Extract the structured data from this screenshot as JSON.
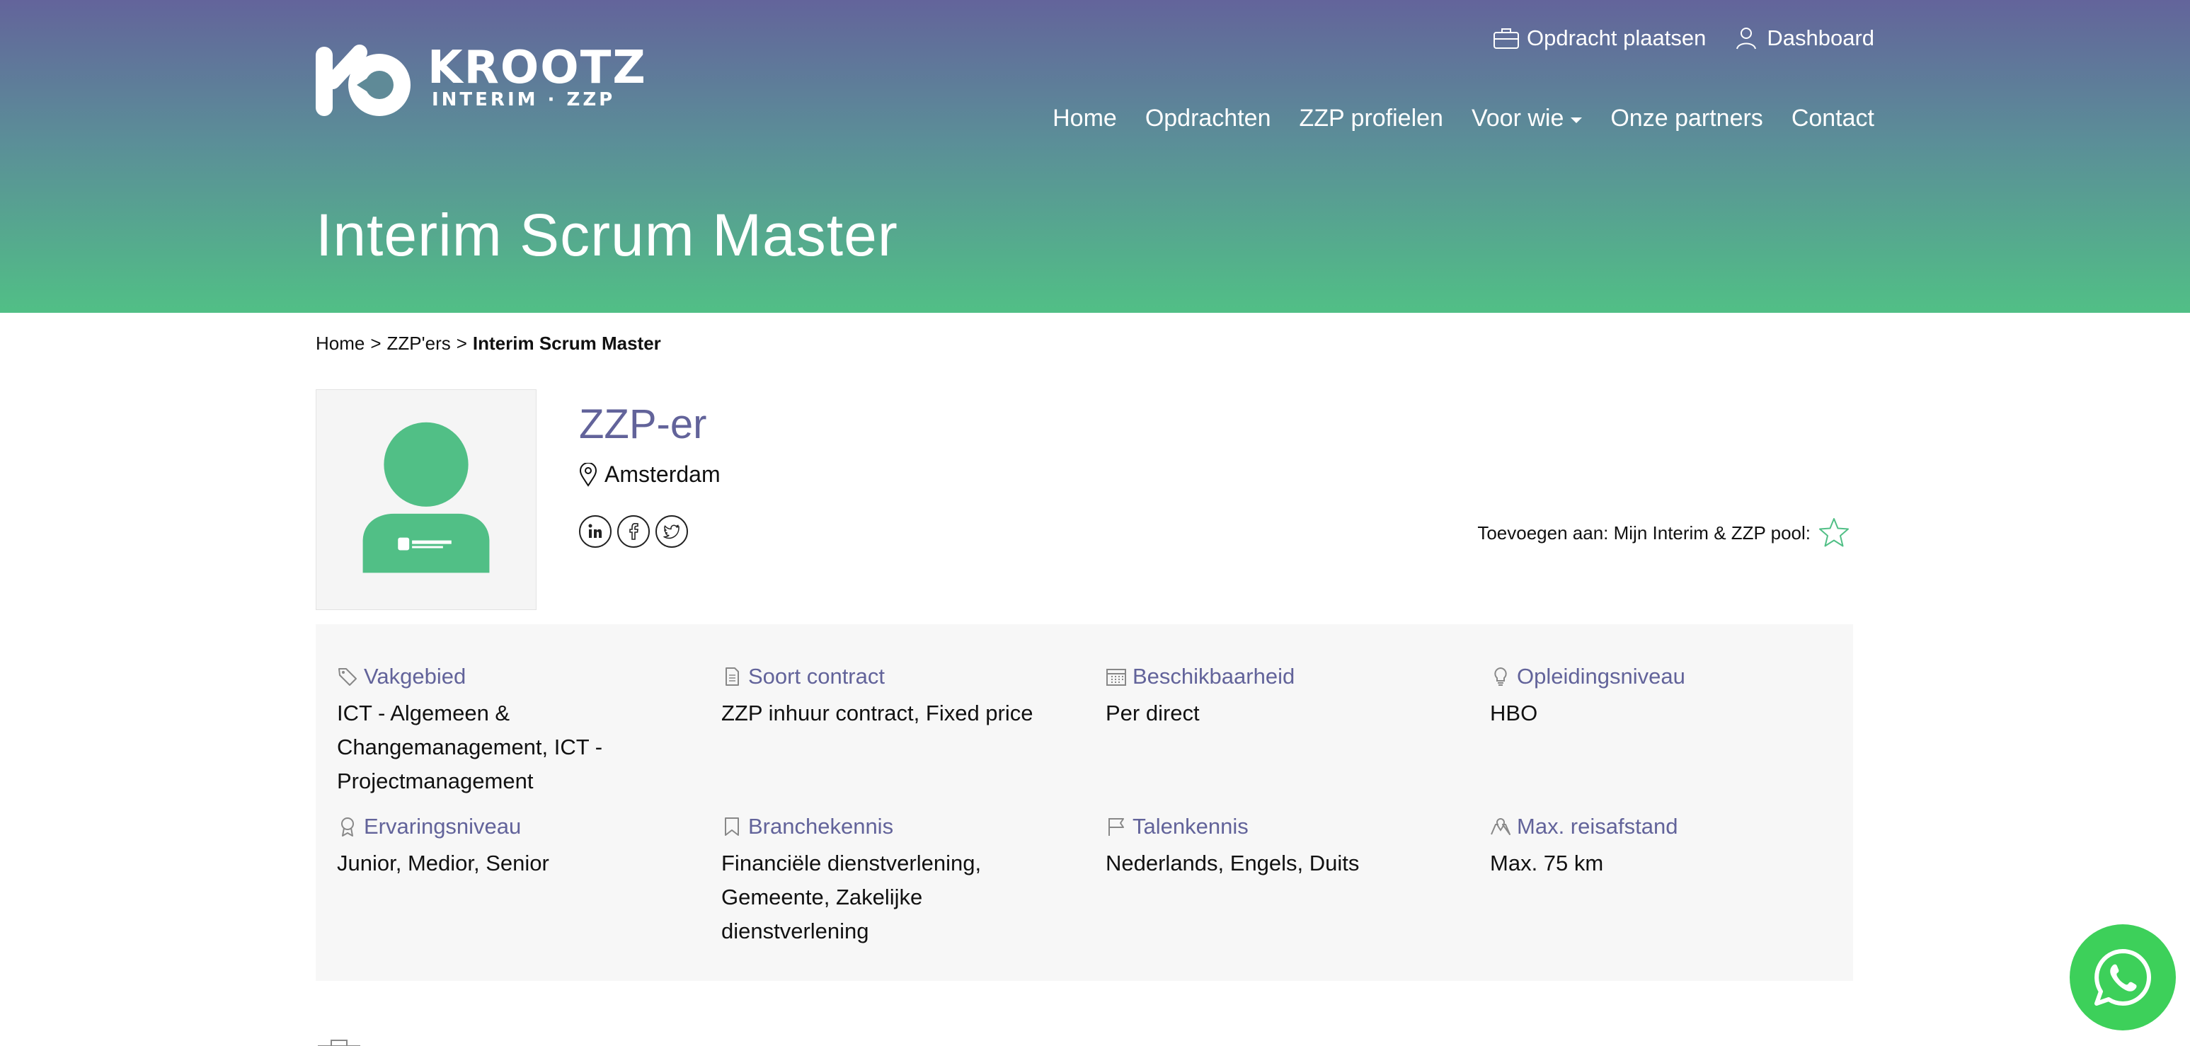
{
  "brand": {
    "name": "KROOTZ",
    "tagline": "INTERIM · ZZP"
  },
  "topnav": [
    {
      "label": "Opdracht plaatsen",
      "icon": "briefcase-icon"
    },
    {
      "label": "Dashboard",
      "icon": "user-icon"
    }
  ],
  "mainnav": [
    {
      "label": "Home"
    },
    {
      "label": "Opdrachten"
    },
    {
      "label": "ZZP profielen"
    },
    {
      "label": "Voor wie",
      "has_dropdown": true
    },
    {
      "label": "Onze partners"
    },
    {
      "label": "Contact"
    }
  ],
  "page_title": "Interim Scrum Master",
  "breadcrumb": {
    "home": "Home",
    "sep": ">",
    "section": "ZZP'ers",
    "current": "Interim Scrum Master"
  },
  "profile": {
    "name": "ZZP-er",
    "location": "Amsterdam"
  },
  "socials": [
    "linkedin-icon",
    "facebook-icon",
    "twitter-icon"
  ],
  "pool": {
    "label": "Toevoegen aan: Mijn Interim & ZZP pool:"
  },
  "details": [
    {
      "label": "Vakgebied",
      "value": "ICT - Algemeen & Changemanagement, ICT - Projectmanagement",
      "icon": "tag-icon"
    },
    {
      "label": "Soort contract",
      "value": "ZZP inhuur contract, Fixed price",
      "icon": "document-icon"
    },
    {
      "label": "Beschikbaarheid",
      "value": "Per direct",
      "icon": "calendar-icon"
    },
    {
      "label": "Opleidingsniveau",
      "value": "HBO",
      "icon": "lightbulb-icon"
    },
    {
      "label": "Ervaringsniveau",
      "value": "Junior, Medior, Senior",
      "icon": "award-icon"
    },
    {
      "label": "Branchekennis",
      "value": "Financiële dienstverlening, Gemeente, Zakelijke dienstverlening",
      "icon": "bookmark-icon"
    },
    {
      "label": "Talenkennis",
      "value": "Nederlands, Engels, Duits",
      "icon": "flag-icon"
    },
    {
      "label": "Max. reisafstand",
      "value": "Max. 75 km",
      "icon": "map-icon"
    }
  ],
  "colors": {
    "accent": "#62639a",
    "green": "#51bf86",
    "whatsapp": "#3dd05a"
  }
}
